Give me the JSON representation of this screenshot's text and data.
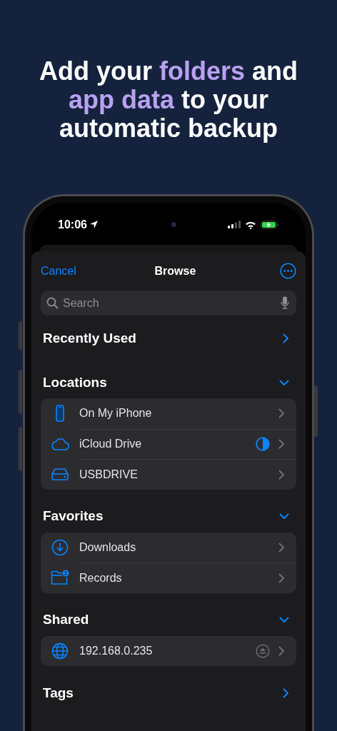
{
  "headline": [
    {
      "text": "Add your ",
      "highlight": false
    },
    {
      "text": "folders",
      "highlight": true
    },
    {
      "text": " and",
      "highlight": false
    },
    {
      "text": "app data",
      "highlight": true,
      "break_before": true
    },
    {
      "text": " to your",
      "highlight": false
    },
    {
      "text": "automatic backup",
      "highlight": false,
      "break_before": true
    }
  ],
  "status_bar": {
    "time": "10:06"
  },
  "nav": {
    "cancel": "Cancel",
    "title": "Browse"
  },
  "search": {
    "placeholder": "Search"
  },
  "sections": [
    {
      "kind": "link",
      "title": "Recently Used"
    },
    {
      "kind": "group",
      "title": "Locations",
      "expanded": true,
      "items": [
        {
          "kind": "phone",
          "label": "On My iPhone"
        },
        {
          "kind": "cloud",
          "label": "iCloud Drive",
          "level": 0.5
        },
        {
          "kind": "drive",
          "label": "USBDRIVE"
        }
      ]
    },
    {
      "kind": "group",
      "title": "Favorites",
      "expanded": true,
      "items": [
        {
          "kind": "download",
          "label": "Downloads"
        },
        {
          "kind": "folder",
          "label": "Records"
        }
      ]
    },
    {
      "kind": "group",
      "title": "Shared",
      "expanded": true,
      "items": [
        {
          "kind": "server",
          "label": "192.168.0.235",
          "ejectable": true
        }
      ]
    },
    {
      "kind": "link",
      "title": "Tags"
    }
  ]
}
